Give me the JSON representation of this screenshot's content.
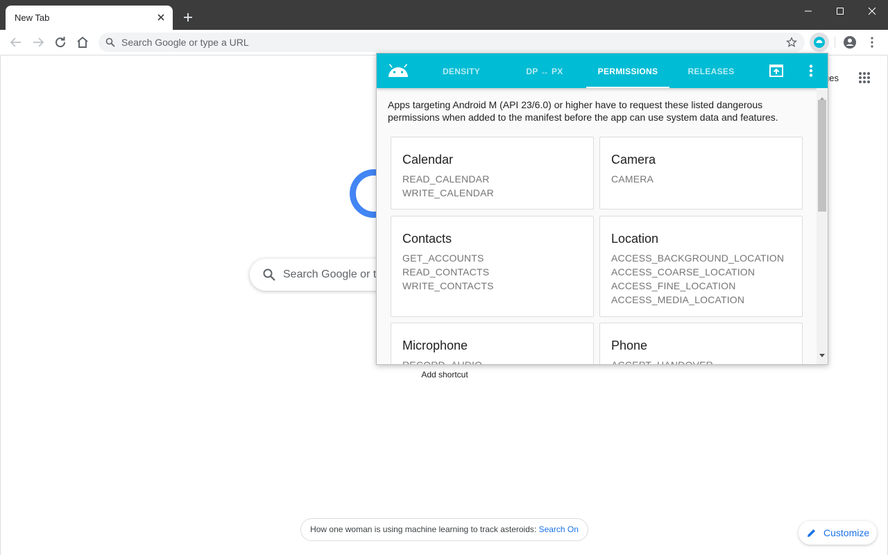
{
  "browser": {
    "tab_title": "New Tab",
    "omnibox_placeholder": "Search Google or type a URL"
  },
  "ntp": {
    "images_link_partial": "ges",
    "search_placeholder_partial": "Search Google or ty",
    "add_shortcut_label": "Add shortcut",
    "promo_text": "How one woman is using machine learning to track asteroids: ",
    "promo_link": "Search On",
    "customize_label": "Customize"
  },
  "popup": {
    "accent_color": "#00bcd4",
    "tabs": [
      {
        "label": "DENSITY",
        "active": false
      },
      {
        "label": "DP ↔ PX",
        "active": false
      },
      {
        "label": "PERMISSIONS",
        "active": true
      },
      {
        "label": "RELEASES",
        "active": false
      }
    ],
    "intro": "Apps targeting Android M (API 23/6.0) or higher have to request these listed dangerous permissions when added to the manifest before the app can use system data and features.",
    "cards": [
      {
        "title": "Calendar",
        "permissions": [
          "READ_CALENDAR",
          "WRITE_CALENDAR"
        ]
      },
      {
        "title": "Camera",
        "permissions": [
          "CAMERA"
        ]
      },
      {
        "title": "Contacts",
        "permissions": [
          "GET_ACCOUNTS",
          "READ_CONTACTS",
          "WRITE_CONTACTS"
        ]
      },
      {
        "title": "Location",
        "permissions": [
          "ACCESS_BACKGROUND_LOCATION",
          "ACCESS_COARSE_LOCATION",
          "ACCESS_FINE_LOCATION",
          "ACCESS_MEDIA_LOCATION"
        ]
      },
      {
        "title": "Microphone",
        "permissions": [
          "RECORD_AUDIO"
        ]
      },
      {
        "title": "Phone",
        "permissions": [
          "ACCEPT_HANDOVER"
        ]
      }
    ]
  }
}
